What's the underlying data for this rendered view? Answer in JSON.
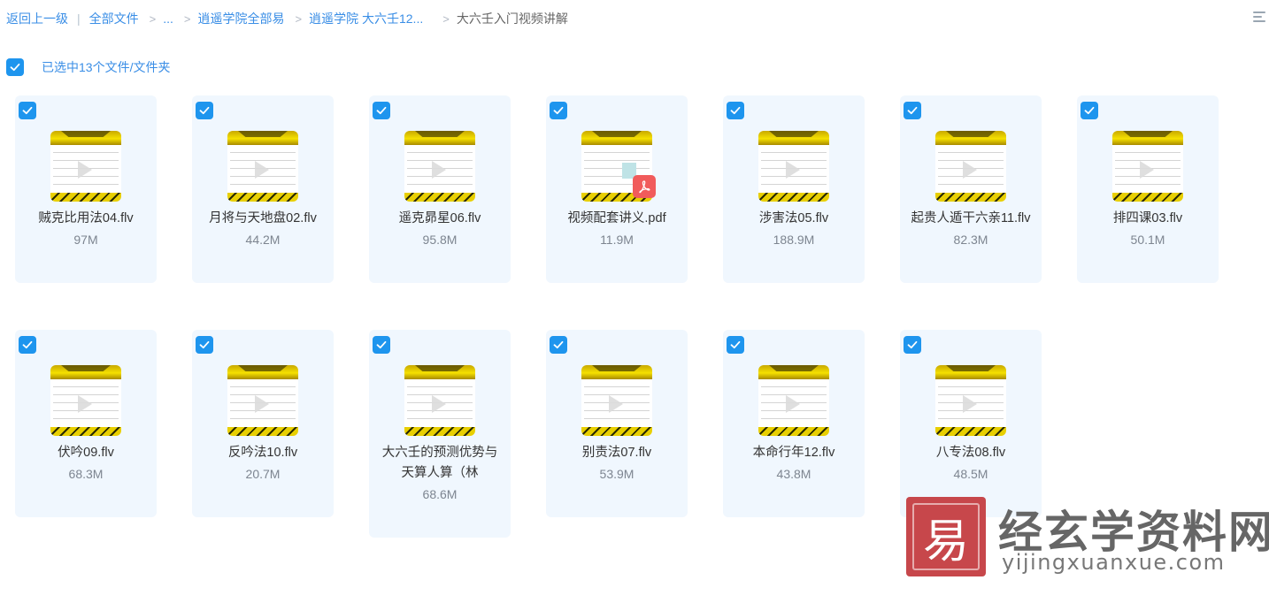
{
  "breadcrumb": {
    "back": "返回上一级",
    "all_files": "全部文件",
    "ellipsis": "...",
    "level1": "逍遥学院全部易",
    "level2": "逍遥学院 大六壬12...",
    "current": "大六壬入门视频讲解",
    "separator": ">"
  },
  "selection": {
    "label": "已选中13个文件/文件夹",
    "all_checked": true
  },
  "accent_color": "#1e95ee",
  "files": [
    {
      "name": "贼克比用法04.flv",
      "size": "97M",
      "type": "video",
      "checked": true
    },
    {
      "name": "月将与天地盘02.flv",
      "size": "44.2M",
      "type": "video",
      "checked": true
    },
    {
      "name": "遥克昴星06.flv",
      "size": "95.8M",
      "type": "video",
      "checked": true
    },
    {
      "name": "视频配套讲义.pdf",
      "size": "11.9M",
      "type": "pdf",
      "checked": true
    },
    {
      "name": "涉害法05.flv",
      "size": "188.9M",
      "type": "video",
      "checked": true
    },
    {
      "name": "起贵人遁干六亲11.flv",
      "size": "82.3M",
      "type": "video",
      "checked": true
    },
    {
      "name": "排四课03.flv",
      "size": "50.1M",
      "type": "video",
      "checked": true
    },
    {
      "name": "伏吟09.flv",
      "size": "68.3M",
      "type": "video",
      "checked": true
    },
    {
      "name": "反吟法10.flv",
      "size": "20.7M",
      "type": "video",
      "checked": true
    },
    {
      "name": "大六壬的预测优势与天算人算（林",
      "size": "68.6M",
      "type": "video",
      "checked": true
    },
    {
      "name": "别责法07.flv",
      "size": "53.9M",
      "type": "video",
      "checked": true
    },
    {
      "name": "本命行年12.flv",
      "size": "43.8M",
      "type": "video",
      "checked": true
    },
    {
      "name": "八专法08.flv",
      "size": "48.5M",
      "type": "video",
      "checked": true
    }
  ],
  "watermark": {
    "title": "经玄学资料网",
    "url": "yijingxuanxue.com",
    "seal_char": "易"
  }
}
